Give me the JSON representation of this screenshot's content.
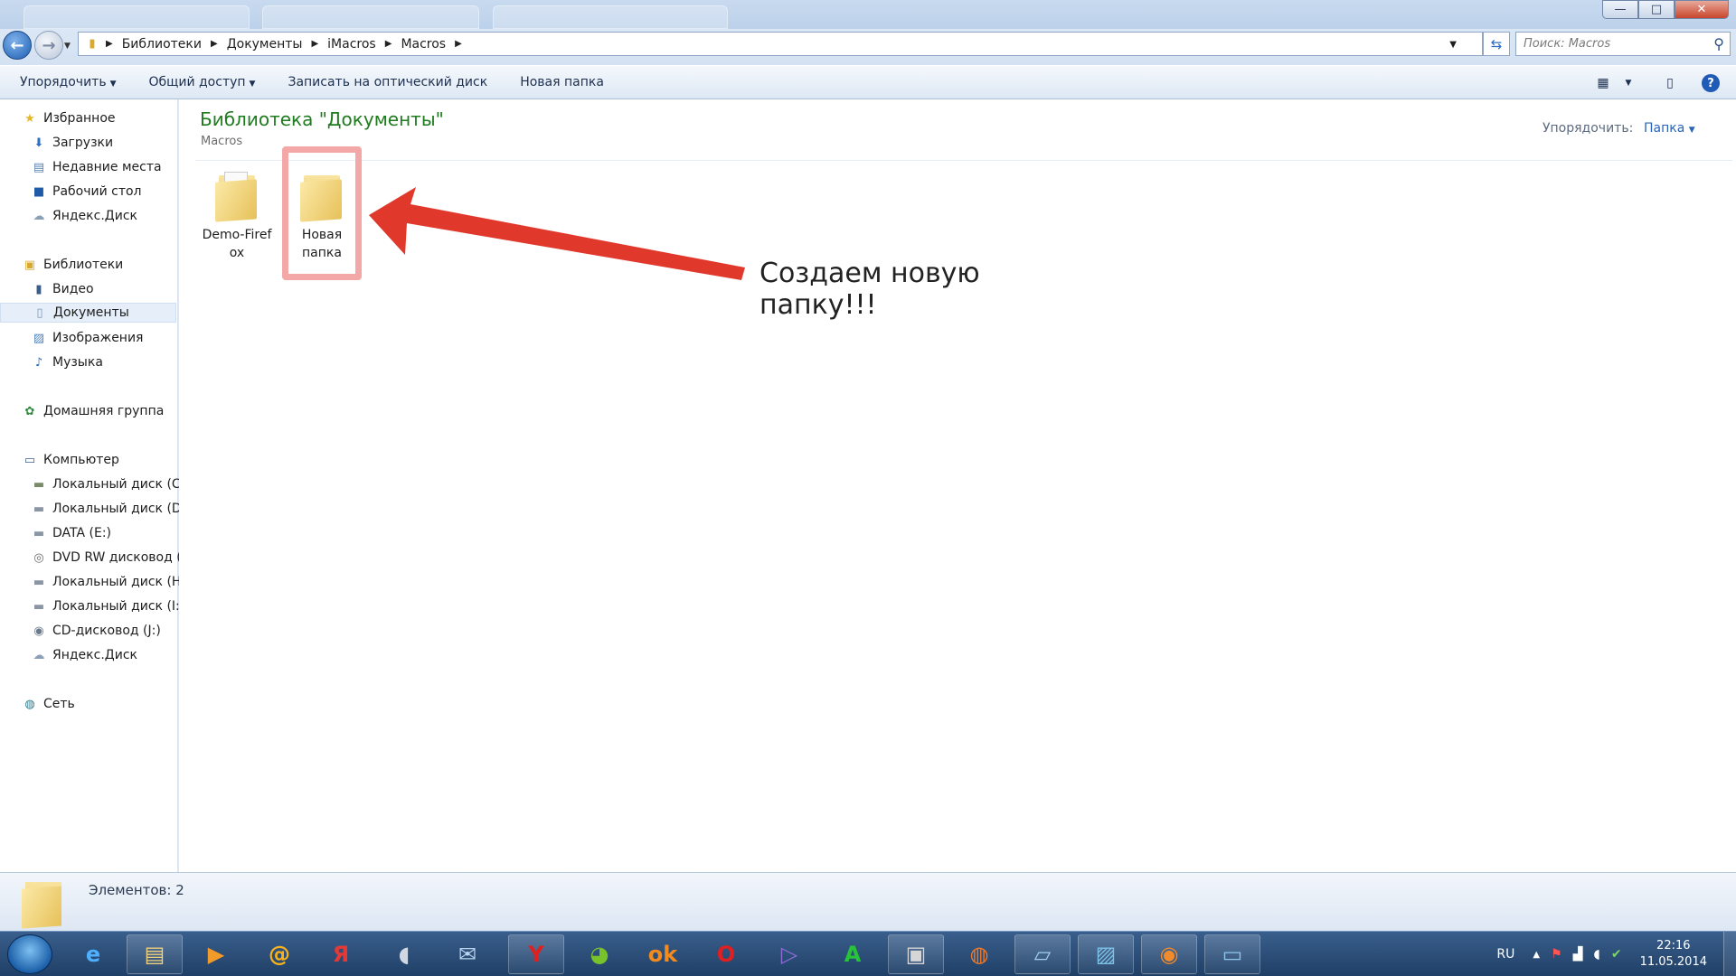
{
  "window": {
    "minimize": "—",
    "maximize": "□",
    "close": "✕"
  },
  "address": {
    "crumbs": [
      "Библиотеки",
      "Документы",
      "iMacros",
      "Macros"
    ],
    "search_placeholder": "Поиск: Macros"
  },
  "commands": {
    "organize": "Упорядочить",
    "share": "Общий доступ",
    "burn": "Записать на оптический диск",
    "new_folder": "Новая папка"
  },
  "nav": {
    "favorites": "Избранное",
    "downloads": "Загрузки",
    "recent": "Недавние места",
    "desktop": "Рабочий стол",
    "yadisk1": "Яндекс.Диск",
    "libraries": "Библиотеки",
    "video": "Видео",
    "documents": "Документы",
    "images": "Изображения",
    "music": "Музыка",
    "homegroup": "Домашняя группа",
    "computer": "Компьютер",
    "disk_c": "Локальный диск (C:",
    "disk_d": "Локальный диск (D:",
    "data_e": "DATA (E:)",
    "dvd": "DVD RW дисковод (",
    "disk_h": "Локальный диск (H:",
    "disk_i": "Локальный диск (I:)",
    "cd_j": "CD-дисковод (J:)",
    "yadisk2": "Яндекс.Диск",
    "network": "Сеть"
  },
  "content": {
    "title": "Библиотека \"Документы\"",
    "subtitle": "Macros",
    "arrange_label": "Упорядочить:",
    "arrange_value": "Папка",
    "files": [
      {
        "line1": "Demo-Firef",
        "line2": "ox"
      },
      {
        "line1": "Новая",
        "line2": "папка"
      }
    ],
    "annotation": "Создаем новую папку!!!"
  },
  "details": {
    "count": "Элементов: 2"
  },
  "taskbar": {
    "lang": "RU",
    "time": "22:16",
    "date": "11.05.2014"
  }
}
